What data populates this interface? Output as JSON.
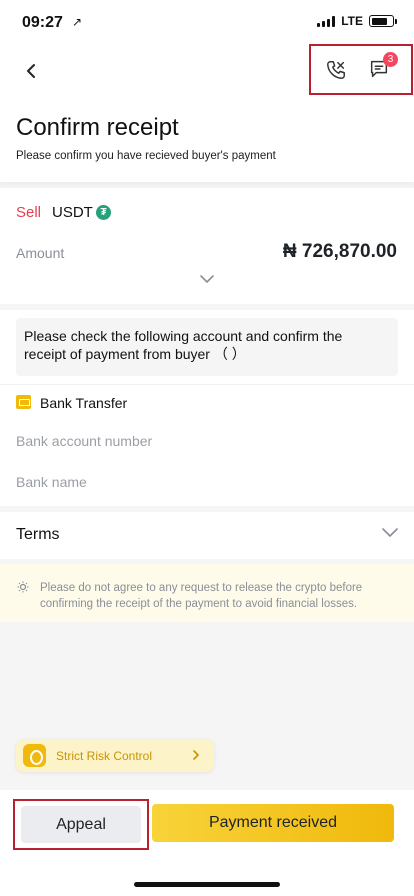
{
  "status_bar": {
    "time": "09:27",
    "location_arrow": "↗",
    "network": "LTE",
    "battery_level": 0.75
  },
  "nav": {
    "back_icon": "chevron-left-icon",
    "call_icon": "phone-icon",
    "chat_icon": "chat-icon",
    "chat_badge": "3"
  },
  "header": {
    "title": "Confirm receipt",
    "subtitle": "Please confirm you have recieved buyer's payment"
  },
  "order": {
    "side": "Sell",
    "asset": "USDT",
    "asset_icon_glyph": "₮",
    "amount_label": "Amount",
    "amount_value": "₦ 726,870.00"
  },
  "account_notice": {
    "line1": "Please check the following account and confirm the",
    "line2": "receipt of payment from buyer （                       ）"
  },
  "payment": {
    "method": "Bank Transfer",
    "fields": [
      {
        "label": "Bank account number"
      },
      {
        "label": "Bank name"
      }
    ]
  },
  "terms": {
    "label": "Terms"
  },
  "warning": {
    "text": "Please do not agree to any request to release the crypto before confirming the receipt of the payment to avoid financial losses."
  },
  "risk_control": {
    "label": "Strict Risk Control"
  },
  "actions": {
    "appeal": "Appeal",
    "received": "Payment received"
  },
  "colors": {
    "sell": "#e2414f",
    "accent": "#f0b90b",
    "highlight_border": "#b8212f",
    "badge": "#f6465d",
    "usdt": "#26a17b"
  }
}
